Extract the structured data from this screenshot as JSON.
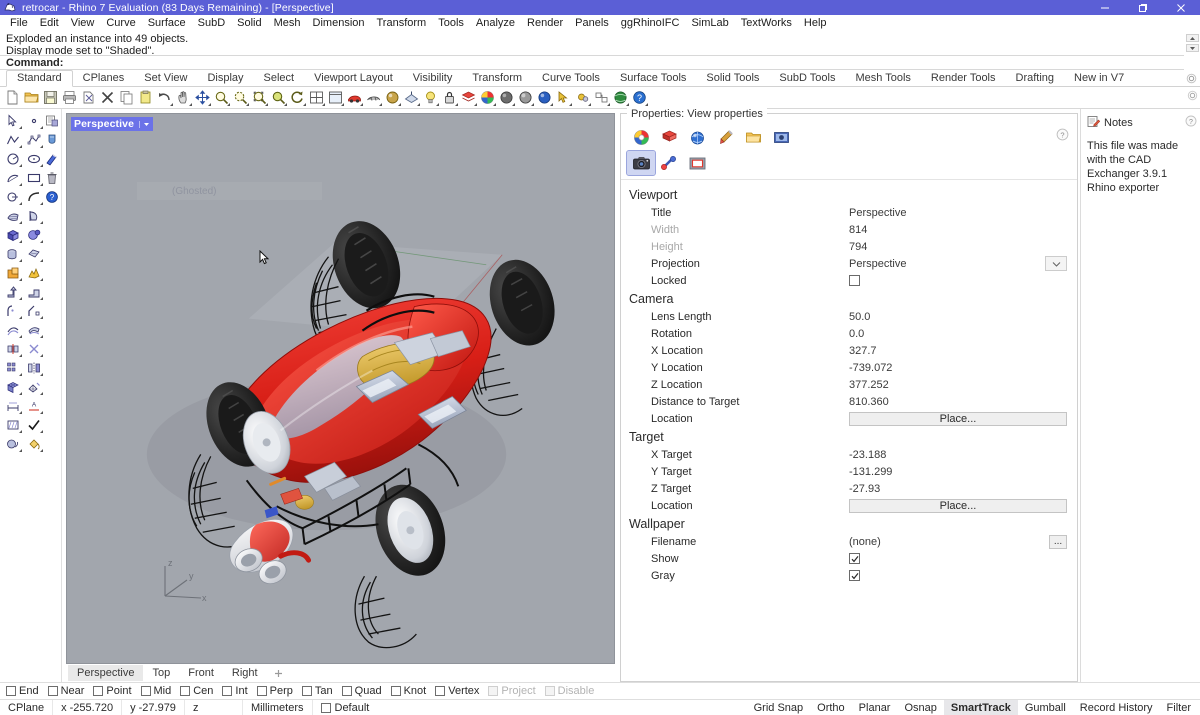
{
  "window": {
    "title": "retrocar - Rhino 7 Evaluation (83 Days Remaining) - [Perspective]",
    "app_icon": "rhino-logo-icon",
    "accent_color": "#5b5fd6",
    "minimize_label": "Minimize",
    "restore_label": "Restore",
    "close_label": "Close"
  },
  "menubar": {
    "items": [
      "File",
      "Edit",
      "View",
      "Curve",
      "Surface",
      "SubD",
      "Solid",
      "Mesh",
      "Dimension",
      "Transform",
      "Tools",
      "Analyze",
      "Render",
      "Panels",
      "ggRhinoIFC",
      "SimLab",
      "TextWorks",
      "Help"
    ]
  },
  "command_area": {
    "history": [
      "Exploded an instance into 49 objects.",
      "Display mode set to \"Shaded\"."
    ],
    "prompt_label": "Command:",
    "input_value": "",
    "input_placeholder": ""
  },
  "toolbar_tabs": {
    "items": [
      "Standard",
      "CPlanes",
      "Set View",
      "Display",
      "Select",
      "Viewport Layout",
      "Visibility",
      "Transform",
      "Curve Tools",
      "Surface Tools",
      "Solid Tools",
      "SubD Tools",
      "Mesh Tools",
      "Render Tools",
      "Drafting",
      "New in V7"
    ],
    "active": "Standard",
    "options_icon": "gear-icon"
  },
  "icon_toolbar": {
    "items": [
      {
        "name": "new-file-icon",
        "tip": "New"
      },
      {
        "name": "open-file-icon",
        "tip": "Open"
      },
      {
        "name": "save-file-icon",
        "tip": "Save"
      },
      {
        "name": "print-icon",
        "tip": "Print"
      },
      {
        "name": "cut-icon",
        "tip": "Cut"
      },
      {
        "name": "delete-icon",
        "tip": "Delete"
      },
      {
        "name": "copy-icon",
        "tip": "Copy"
      },
      {
        "name": "paste-icon",
        "tip": "Paste"
      },
      {
        "name": "undo-icon",
        "tip": "Undo"
      },
      {
        "name": "pan-icon",
        "tip": "Pan"
      },
      {
        "name": "move-icon",
        "tip": "Move"
      },
      {
        "name": "zoom-window-icon",
        "tip": "Zoom Window"
      },
      {
        "name": "zoom-extents-icon",
        "tip": "Zoom Extents"
      },
      {
        "name": "zoom-selected-icon",
        "tip": "Zoom Selected"
      },
      {
        "name": "zoom-dynamic-icon",
        "tip": "Zoom Dynamic"
      },
      {
        "name": "rotate-view-icon",
        "tip": "Rotate View"
      },
      {
        "name": "four-view-icon",
        "tip": "4 Viewports"
      },
      {
        "name": "single-view-icon",
        "tip": "Max Viewport"
      },
      {
        "name": "car-shaded-icon",
        "tip": "Shaded"
      },
      {
        "name": "wireframe-icon",
        "tip": "Wireframe"
      },
      {
        "name": "render-preview-icon",
        "tip": "Render Preview"
      },
      {
        "name": "plane-icon",
        "tip": "CPlane"
      },
      {
        "name": "light-icon",
        "tip": "Lights"
      },
      {
        "name": "lock-icon",
        "tip": "Lock"
      },
      {
        "name": "layer-icon",
        "tip": "Layers"
      },
      {
        "name": "color-wheel-icon",
        "tip": "Color"
      },
      {
        "name": "sphere-gray-icon",
        "tip": "Material"
      },
      {
        "name": "sphere-shade-icon",
        "tip": "Environment"
      },
      {
        "name": "sphere-blue-icon",
        "tip": "Render"
      },
      {
        "name": "arrow-select-icon",
        "tip": "Select"
      },
      {
        "name": "gears-icon",
        "tip": "Options"
      },
      {
        "name": "group-icon",
        "tip": "Group"
      },
      {
        "name": "globe-icon",
        "tip": "Web"
      },
      {
        "name": "help-icon",
        "tip": "Help"
      }
    ],
    "overflow_icon": "gear-icon"
  },
  "left_toolbar": {
    "columns": [
      [
        "select-arrow-icon",
        "point-icon",
        "polyline-icon",
        "control-polygon-icon",
        "circle-icon",
        "ellipse-icon",
        "arc-icon",
        "rectangle-icon",
        "curve-point-icon",
        "curve-blend-icon",
        "surface-patch-icon",
        "surface-revolve-icon",
        "box-icon",
        "sphere-shape-icon",
        "cylinder-icon",
        "surface-extrude-icon",
        "boolean-union-icon",
        "explode-icon",
        "extrude-solid-icon",
        "loft-icon",
        "fillet-icon",
        "chamfer-icon",
        "offset-curve-icon",
        "offset-surface-icon",
        "trim-icon",
        "split-icon",
        "array-icon",
        "mirror-icon",
        "mesh-box-icon",
        "mesh-tools-icon",
        "dimension-linear-icon",
        "dimension-text-icon",
        "hatch-icon",
        "check-icon",
        "render-mesh-icon",
        "paint-bucket-icon"
      ],
      [
        "layer-panel-icon",
        "material-panel-icon",
        "properties-panel-icon",
        "trash-icon",
        "help-panel-icon"
      ]
    ]
  },
  "viewport": {
    "label": "Perspective",
    "dropdown_icon": "chevron-down-icon",
    "background_color": "#a2a6ad",
    "ghost_label": "(Ghosted)",
    "axis": {
      "x": "x",
      "y": "y",
      "z": "z"
    },
    "model_name": "retrocar",
    "cursor_icon": "arrow-cursor-icon",
    "tabs": [
      "Perspective",
      "Top",
      "Front",
      "Right"
    ],
    "active_tab": "Perspective",
    "add_tab_icon": "plus-icon"
  },
  "properties": {
    "caption": "Properties: View properties",
    "tabs_row1": [
      {
        "name": "object-color-icon",
        "label": "Object"
      },
      {
        "name": "layer-material-icon",
        "label": "Material"
      },
      {
        "name": "display-globe-icon",
        "label": "Display"
      },
      {
        "name": "paint-brush-icon",
        "label": "Texture"
      },
      {
        "name": "folder-icon",
        "label": "Attributes"
      },
      {
        "name": "camera-props-icon",
        "label": "View"
      }
    ],
    "tabs_row2": [
      {
        "name": "camera-icon",
        "label": "Camera",
        "active": true
      },
      {
        "name": "link-icon",
        "label": "Linked",
        "active": false
      },
      {
        "name": "frame-icon",
        "label": "Frame",
        "active": false
      }
    ],
    "help_icon": "help-circle-icon",
    "groups": [
      {
        "title": "Viewport",
        "rows": [
          {
            "key": "Title",
            "value": "Perspective",
            "type": "text",
            "dim": false
          },
          {
            "key": "Width",
            "value": "814",
            "type": "text",
            "dim": true
          },
          {
            "key": "Height",
            "value": "794",
            "type": "text",
            "dim": true
          },
          {
            "key": "Projection",
            "value": "Perspective",
            "type": "combo",
            "dim": false
          },
          {
            "key": "Locked",
            "value": "",
            "type": "checkbox",
            "checked": false,
            "dim": false
          }
        ]
      },
      {
        "title": "Camera",
        "rows": [
          {
            "key": "Lens Length",
            "value": "50.0",
            "type": "text",
            "dim": false
          },
          {
            "key": "Rotation",
            "value": "0.0",
            "type": "text",
            "dim": false
          },
          {
            "key": "X Location",
            "value": "327.7",
            "type": "text",
            "dim": false
          },
          {
            "key": "Y Location",
            "value": "-739.072",
            "type": "text",
            "dim": false
          },
          {
            "key": "Z Location",
            "value": "377.252",
            "type": "text",
            "dim": false
          },
          {
            "key": "Distance to Target",
            "value": "810.360",
            "type": "text",
            "dim": false
          },
          {
            "key": "Location",
            "value": "Place...",
            "type": "button",
            "dim": false
          }
        ]
      },
      {
        "title": "Target",
        "rows": [
          {
            "key": "X Target",
            "value": "-23.188",
            "type": "text",
            "dim": false
          },
          {
            "key": "Y Target",
            "value": "-131.299",
            "type": "text",
            "dim": false
          },
          {
            "key": "Z Target",
            "value": "-27.93",
            "type": "text",
            "dim": false
          },
          {
            "key": "Location",
            "value": "Place...",
            "type": "button",
            "dim": false
          }
        ]
      },
      {
        "title": "Wallpaper",
        "rows": [
          {
            "key": "Filename",
            "value": "(none)",
            "type": "ellipsis",
            "dim": false
          },
          {
            "key": "Show",
            "value": "",
            "type": "checkbox",
            "checked": true,
            "dim": false
          },
          {
            "key": "Gray",
            "value": "",
            "type": "checkbox",
            "checked": true,
            "dim": false
          }
        ]
      }
    ]
  },
  "notes": {
    "title": "Notes",
    "icon": "notes-icon",
    "help_icon": "help-circle-icon",
    "text": "This file was made with the CAD Exchanger 3.9.1 Rhino exporter"
  },
  "osnap": {
    "items": [
      {
        "label": "End",
        "checked": false,
        "enabled": true
      },
      {
        "label": "Near",
        "checked": false,
        "enabled": true
      },
      {
        "label": "Point",
        "checked": false,
        "enabled": true
      },
      {
        "label": "Mid",
        "checked": false,
        "enabled": true
      },
      {
        "label": "Cen",
        "checked": false,
        "enabled": true
      },
      {
        "label": "Int",
        "checked": false,
        "enabled": true
      },
      {
        "label": "Perp",
        "checked": false,
        "enabled": true
      },
      {
        "label": "Tan",
        "checked": false,
        "enabled": true
      },
      {
        "label": "Quad",
        "checked": false,
        "enabled": true
      },
      {
        "label": "Knot",
        "checked": false,
        "enabled": true
      },
      {
        "label": "Vertex",
        "checked": false,
        "enabled": true
      },
      {
        "label": "Project",
        "checked": false,
        "enabled": false
      },
      {
        "label": "Disable",
        "checked": false,
        "enabled": false
      }
    ]
  },
  "statusbar": {
    "cplane_label": "CPlane",
    "x_value": "x -255.720",
    "y_value": "y -27.979",
    "z_value": "z",
    "units": "Millimeters",
    "layer_label": "Default",
    "toggles": [
      {
        "label": "Grid Snap",
        "on": false
      },
      {
        "label": "Ortho",
        "on": false
      },
      {
        "label": "Planar",
        "on": false
      },
      {
        "label": "Osnap",
        "on": false
      },
      {
        "label": "SmartTrack",
        "on": true
      },
      {
        "label": "Gumball",
        "on": false
      },
      {
        "label": "Record History",
        "on": false
      },
      {
        "label": "Filter",
        "on": false
      }
    ]
  }
}
